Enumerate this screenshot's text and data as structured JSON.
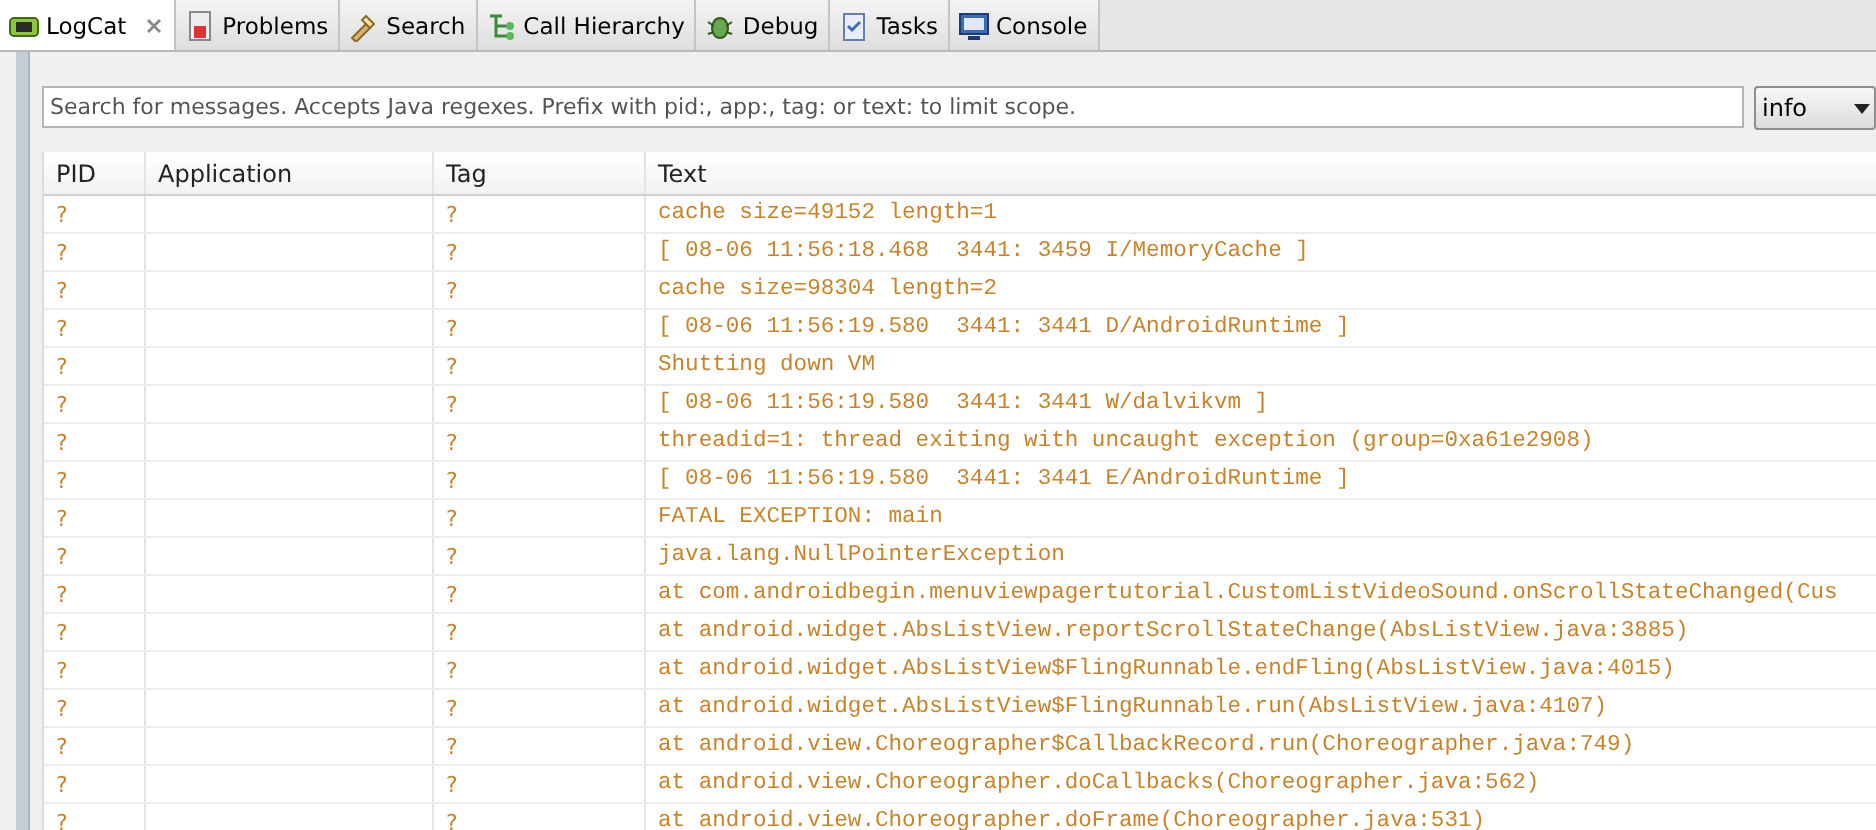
{
  "tabs": [
    {
      "label": "LogCat",
      "selected": true,
      "closable": true,
      "kind": "logcat"
    },
    {
      "label": "Problems",
      "selected": false,
      "closable": false,
      "kind": "problems"
    },
    {
      "label": "Search",
      "selected": false,
      "closable": false,
      "kind": "search"
    },
    {
      "label": "Call Hierarchy",
      "selected": false,
      "closable": false,
      "kind": "hierarchy"
    },
    {
      "label": "Debug",
      "selected": false,
      "closable": false,
      "kind": "debug"
    },
    {
      "label": "Tasks",
      "selected": false,
      "closable": false,
      "kind": "tasks"
    },
    {
      "label": "Console",
      "selected": false,
      "closable": false,
      "kind": "console"
    }
  ],
  "filter": {
    "placeholder": "Search for messages. Accepts Java regexes. Prefix with pid:, app:, tag: or text: to limit scope.",
    "level": "info"
  },
  "table": {
    "columns": [
      "PID",
      "Application",
      "Tag",
      "Text"
    ],
    "rows": [
      {
        "pid": "?",
        "tag": "?",
        "text": "cache size=49152 length=1"
      },
      {
        "pid": "?",
        "tag": "?",
        "text": "[ 08-06 11:56:18.468  3441: 3459 I/MemoryCache ]"
      },
      {
        "pid": "?",
        "tag": "?",
        "text": "cache size=98304 length=2"
      },
      {
        "pid": "?",
        "tag": "?",
        "text": "[ 08-06 11:56:19.580  3441: 3441 D/AndroidRuntime ]"
      },
      {
        "pid": "?",
        "tag": "?",
        "text": "Shutting down VM"
      },
      {
        "pid": "?",
        "tag": "?",
        "text": "[ 08-06 11:56:19.580  3441: 3441 W/dalvikvm ]"
      },
      {
        "pid": "?",
        "tag": "?",
        "text": "threadid=1: thread exiting with uncaught exception (group=0xa61e2908)"
      },
      {
        "pid": "?",
        "tag": "?",
        "text": "[ 08-06 11:56:19.580  3441: 3441 E/AndroidRuntime ]"
      },
      {
        "pid": "?",
        "tag": "?",
        "text": "FATAL EXCEPTION: main"
      },
      {
        "pid": "?",
        "tag": "?",
        "text": "java.lang.NullPointerException"
      },
      {
        "pid": "?",
        "tag": "?",
        "text": "at com.androidbegin.menuviewpagertutorial.CustomListVideoSound.onScrollStateChanged(Cus"
      },
      {
        "pid": "?",
        "tag": "?",
        "text": "at android.widget.AbsListView.reportScrollStateChange(AbsListView.java:3885)"
      },
      {
        "pid": "?",
        "tag": "?",
        "text": "at android.widget.AbsListView$FlingRunnable.endFling(AbsListView.java:4015)"
      },
      {
        "pid": "?",
        "tag": "?",
        "text": "at android.widget.AbsListView$FlingRunnable.run(AbsListView.java:4107)"
      },
      {
        "pid": "?",
        "tag": "?",
        "text": "at android.view.Choreographer$CallbackRecord.run(Choreographer.java:749)"
      },
      {
        "pid": "?",
        "tag": "?",
        "text": "at android.view.Choreographer.doCallbacks(Choreographer.java:562)"
      },
      {
        "pid": "?",
        "tag": "?",
        "text": "at android.view.Choreographer.doFrame(Choreographer.java:531)"
      }
    ]
  }
}
